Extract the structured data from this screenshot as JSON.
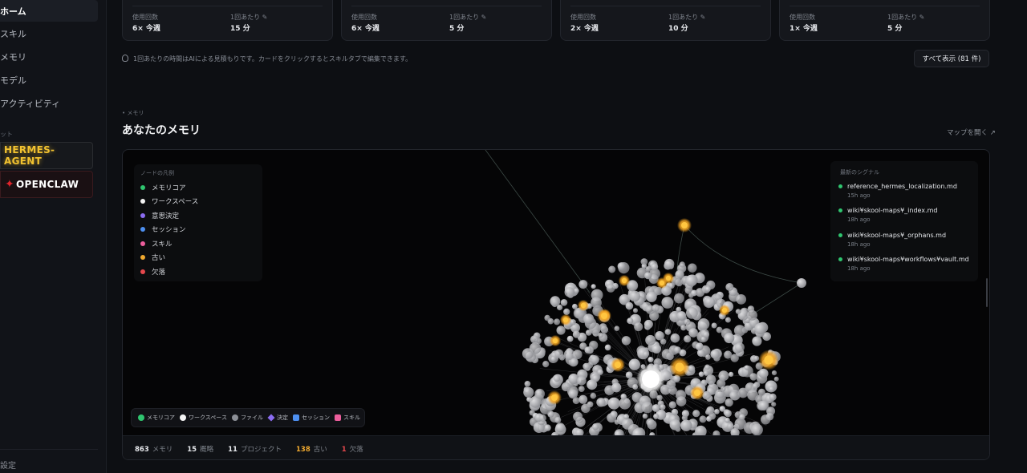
{
  "sidebar": {
    "items": [
      {
        "label": "ホーム",
        "active": true
      },
      {
        "label": "スキル"
      },
      {
        "label": "メモリ"
      },
      {
        "label": "モデル"
      },
      {
        "label": "アクティビティ"
      }
    ],
    "section_label": "ット",
    "agents": [
      {
        "label": "HERMES-AGENT",
        "color": "#f2c230"
      },
      {
        "label": "OPENCLAW",
        "color": "#e0242b"
      }
    ],
    "settings_label": "設定"
  },
  "stats": [
    {
      "usage_label": "使用回数",
      "usage_value": "6× 今週",
      "per_label": "1回あたり",
      "per_value": "15 分"
    },
    {
      "usage_label": "使用回数",
      "usage_value": "6× 今週",
      "per_label": "1回あたり",
      "per_value": "5 分"
    },
    {
      "usage_label": "使用回数",
      "usage_value": "2× 今週",
      "per_label": "1回あたり",
      "per_value": "10 分"
    },
    {
      "usage_label": "使用回数",
      "usage_value": "1× 今週",
      "per_label": "1回あたり",
      "per_value": "5 分"
    }
  ],
  "hint_text": "1回あたりの時間はAIによる見積もりです。カードをクリックするとスキルタブで編集できます。",
  "show_all_label": "すべて表示 (81 件)",
  "memory": {
    "section_tag": "メモリ",
    "title": "あなたのメモリ",
    "open_map_label": "マップを開く ↗",
    "legend": {
      "title": "ノードの凡例",
      "items": [
        {
          "label": "メモリコア",
          "color": "#2fc56f"
        },
        {
          "label": "ワークスペース",
          "color": "#f4f4f4"
        },
        {
          "label": "意思決定",
          "color": "#8b6cf0"
        },
        {
          "label": "セッション",
          "color": "#4d8ff0"
        },
        {
          "label": "スキル",
          "color": "#ec5e9c"
        },
        {
          "label": "古い",
          "color": "#f0a92f"
        },
        {
          "label": "欠落",
          "color": "#e5484d"
        }
      ]
    },
    "signals": {
      "title": "最新のシグナル",
      "items": [
        {
          "name": "reference_hermes_localization.md",
          "time": "15h ago"
        },
        {
          "name": "wiki¥skool-maps¥_index.md",
          "time": "18h ago"
        },
        {
          "name": "wiki¥skool-maps¥_orphans.md",
          "time": "18h ago"
        },
        {
          "name": "wiki¥skool-maps¥workflows¥vault.md",
          "time": "18h ago"
        }
      ]
    },
    "types": [
      {
        "label": "メモリコア",
        "color": "#2fc56f",
        "shape": "circle"
      },
      {
        "label": "ワークスペース",
        "color": "#f4f4f4",
        "shape": "circle"
      },
      {
        "label": "ファイル",
        "color": "#8c8f96",
        "shape": "circle"
      },
      {
        "label": "決定",
        "color": "#8b6cf0",
        "shape": "diamond"
      },
      {
        "label": "セッション",
        "color": "#4d8ff0",
        "shape": "square"
      },
      {
        "label": "スキル",
        "color": "#ec5e9c",
        "shape": "square"
      }
    ],
    "footer": {
      "memories": "863",
      "memories_label": "メモリ",
      "summaries": "15",
      "summaries_label": "概略",
      "projects": "11",
      "projects_label": "プロジェクト",
      "stale": "138",
      "stale_label": "古い",
      "broken": "1",
      "broken_label": "欠落"
    }
  }
}
